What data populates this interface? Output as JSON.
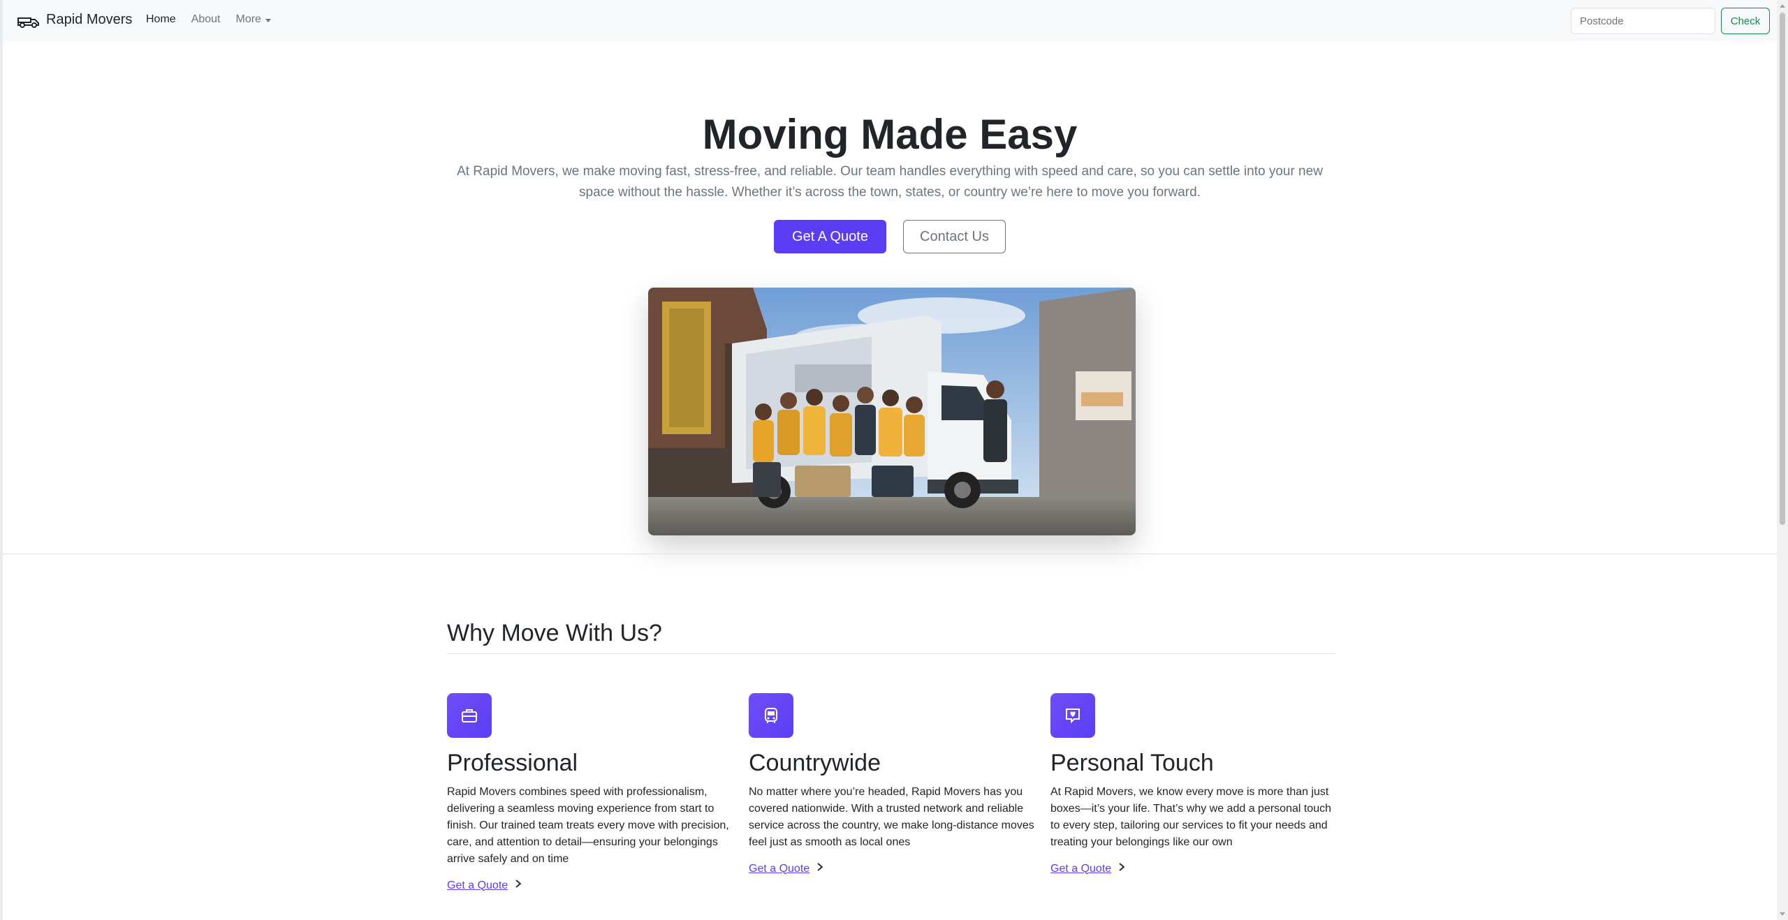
{
  "navbar": {
    "brand_icon": "truck-icon",
    "brand_name": "Rapid Movers",
    "links": [
      {
        "label": "Home",
        "active": true
      },
      {
        "label": "About",
        "active": false
      }
    ],
    "more_label": "More",
    "postcode_placeholder": "Postcode",
    "check_label": "Check"
  },
  "hero": {
    "title": "Moving Made Easy",
    "description": "At Rapid Movers, we make moving fast, stress-free, and reliable. Our team handles everything with speed and care, so you can settle into your new space without the hassle. Whether it’s across the town, states, or country we’re here to move you forward.",
    "primary_label": "Get A Quote",
    "secondary_label": "Contact Us"
  },
  "features": {
    "title": "Why Move With Us?",
    "items": [
      {
        "icon": "briefcase-icon",
        "title": "Professional",
        "text": "Rapid Movers combines speed with professionalism, delivering a seamless moving experience from start to finish. Our trained team treats every move with precision, care, and attention to detail—ensuring your belongings arrive safely and on time",
        "link": "Get a Quote"
      },
      {
        "icon": "bus-icon",
        "title": "Countrywide",
        "text": "No matter where you’re headed, Rapid Movers has you covered nationwide. With a trusted network and reliable service across the country, we make long-distance moves feel just as smooth as local ones",
        "link": "Get a Quote"
      },
      {
        "icon": "heart-message-icon",
        "title": "Personal Touch",
        "text": "At Rapid Movers, we know every move is more than just boxes—it’s your life. That’s why we add a personal touch to every step, tailoring our services to fit your needs and treating your belongings like our own",
        "link": "Get a Quote"
      }
    ]
  },
  "colors": {
    "accent": "#5b3df6",
    "check_green": "#198754",
    "muted": "#6c757d"
  }
}
